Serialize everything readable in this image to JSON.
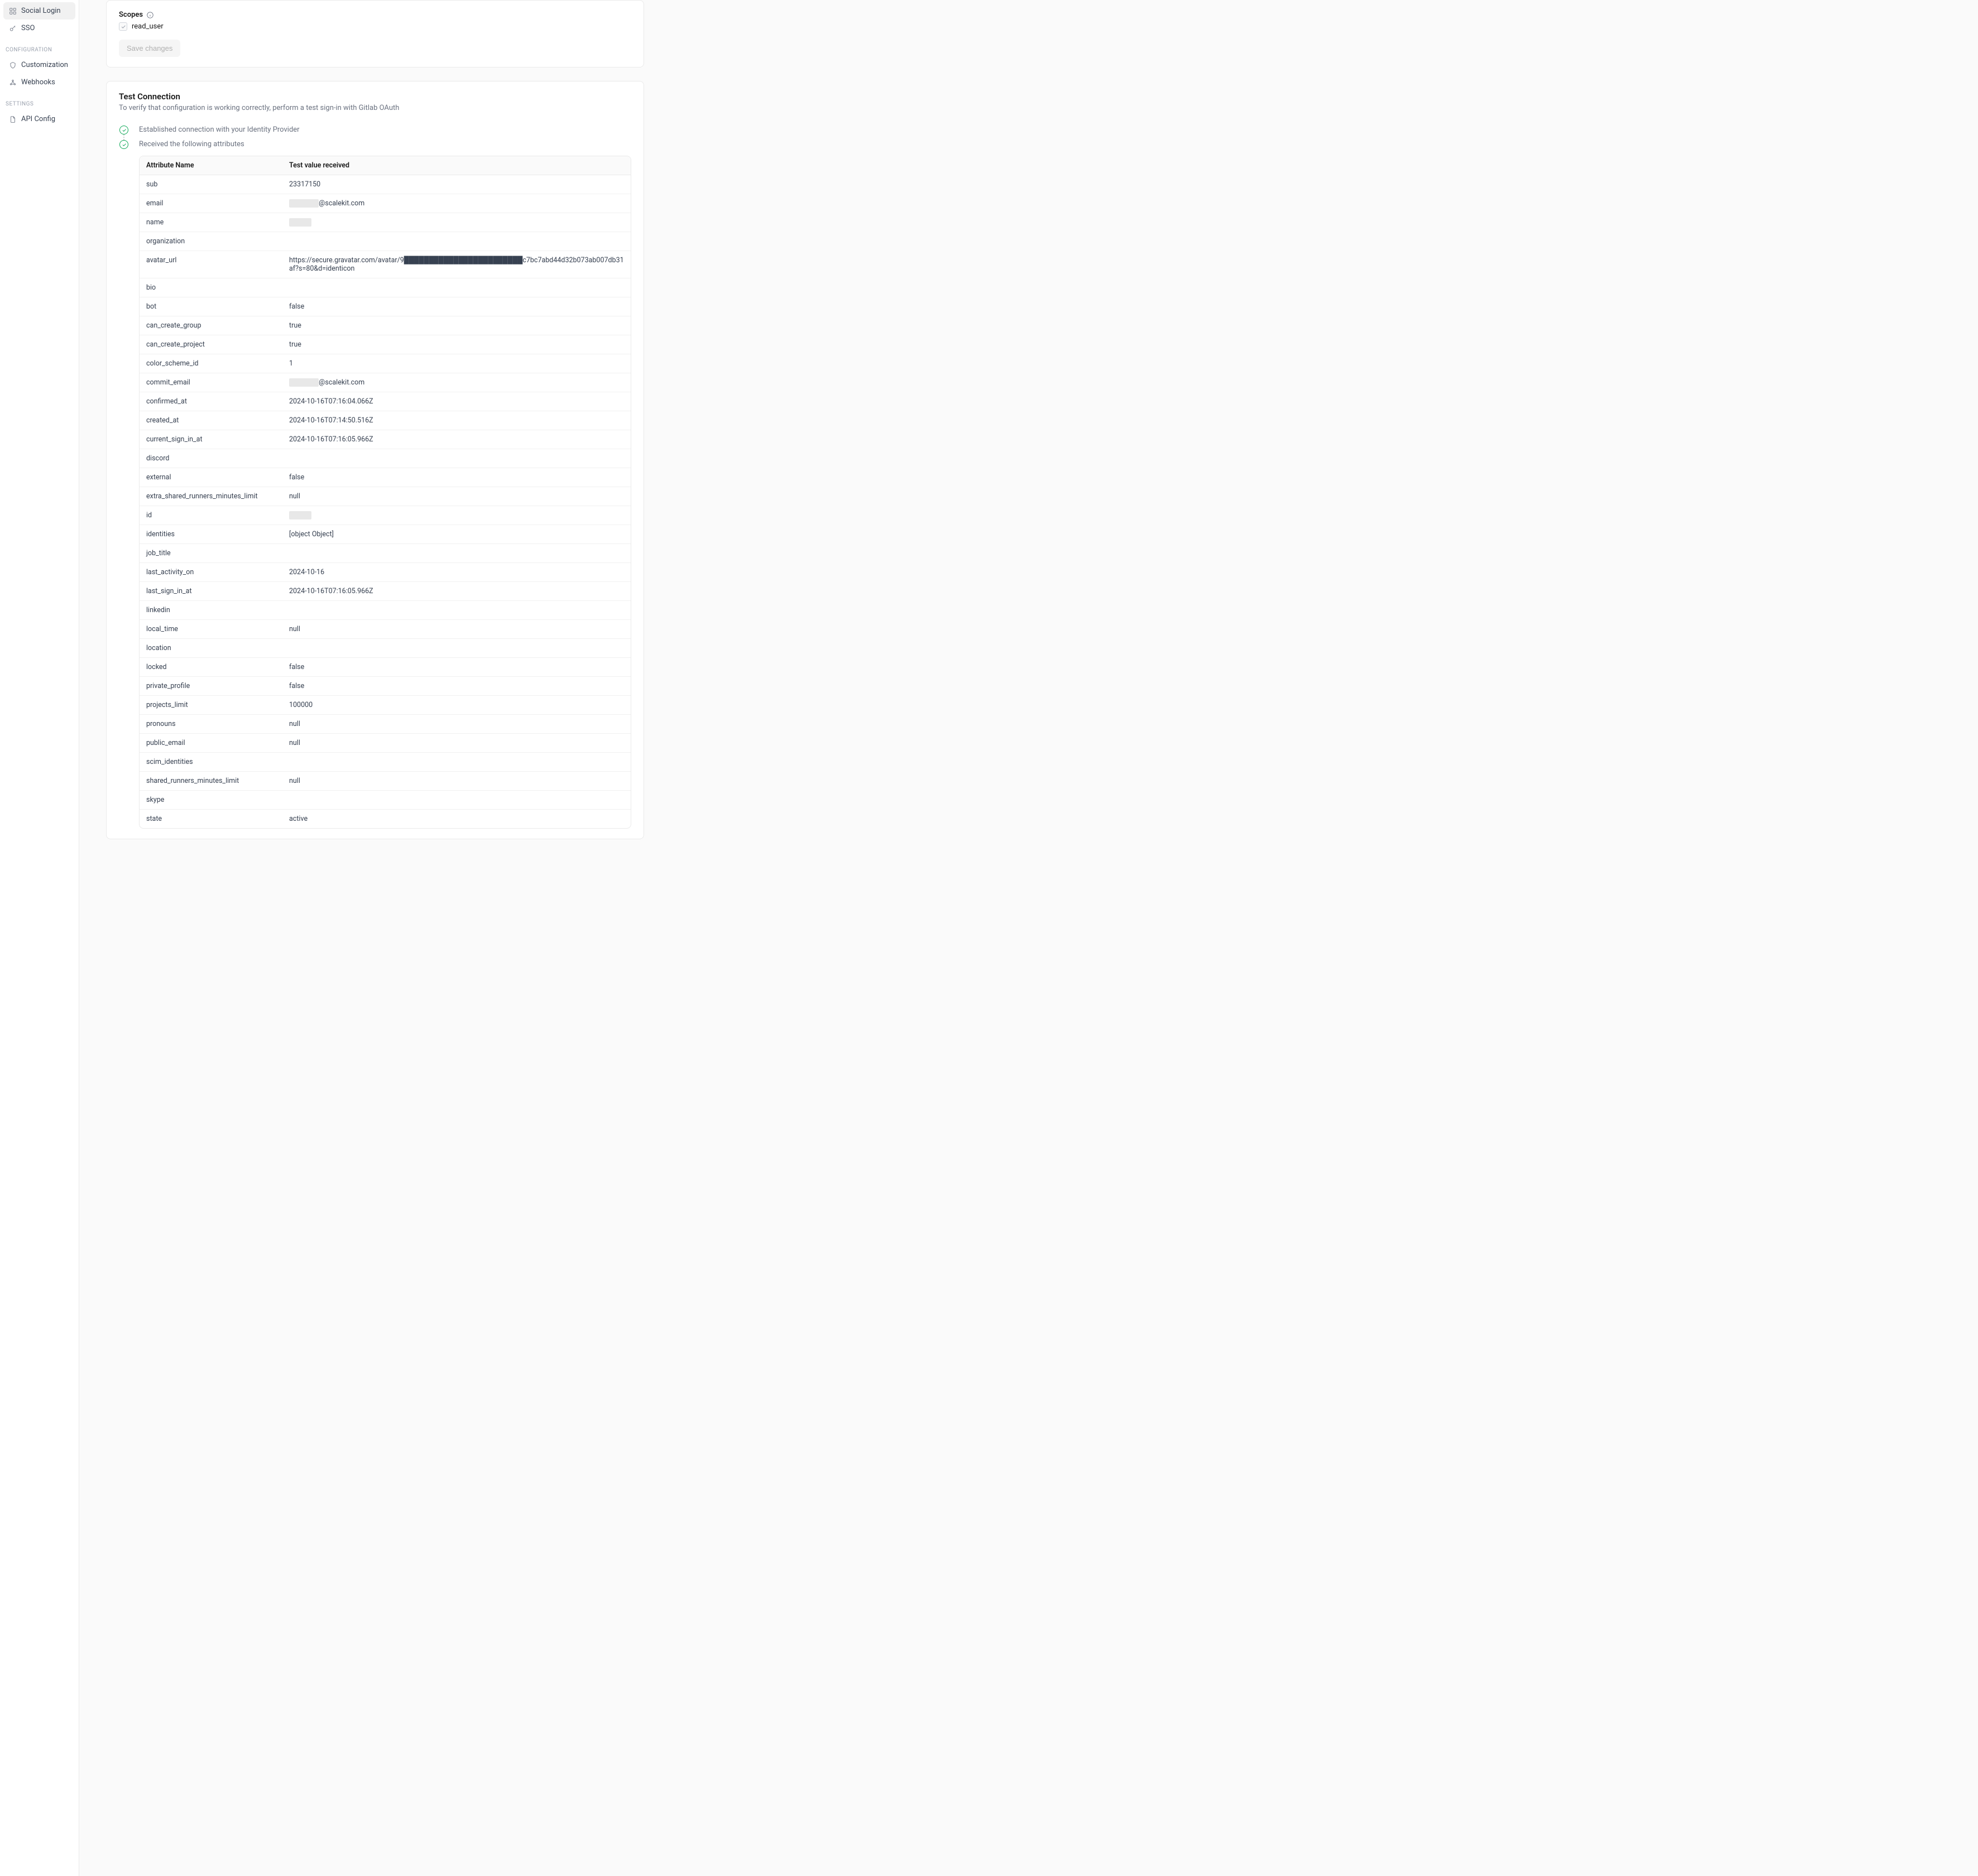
{
  "sidebar": {
    "items": {
      "social_login": "Social Login",
      "sso": "SSO",
      "customization": "Customization",
      "webhooks": "Webhooks",
      "api_config": "API Config"
    },
    "sections": {
      "configuration": "CONFIGURATION",
      "settings": "SETTINGS"
    }
  },
  "scopes": {
    "title": "Scopes",
    "item": "read_user",
    "save_button": "Save changes"
  },
  "test": {
    "title": "Test Connection",
    "description": "To verify that configuration is working correctly, perform a test sign-in with Gitlab OAuth",
    "step1": "Established connection with your Identity Provider",
    "step2": "Received the following attributes",
    "table": {
      "col1": "Attribute Name",
      "col2": "Test value received",
      "rows": [
        {
          "name": "sub",
          "value": "23317150"
        },
        {
          "name": "email",
          "value": "",
          "redacted_email": true,
          "domain": "@scalekit.com"
        },
        {
          "name": "name",
          "value": "",
          "redacted": true
        },
        {
          "name": "organization",
          "value": ""
        },
        {
          "name": "avatar_url",
          "value": "https://secure.gravatar.com/avatar/9████████████████████████c7bc7abd44d32b073ab007db31af?s=80&d=identicon"
        },
        {
          "name": "bio",
          "value": ""
        },
        {
          "name": "bot",
          "value": "false"
        },
        {
          "name": "can_create_group",
          "value": "true"
        },
        {
          "name": "can_create_project",
          "value": "true"
        },
        {
          "name": "color_scheme_id",
          "value": "1"
        },
        {
          "name": "commit_email",
          "value": "",
          "redacted_email": true,
          "domain": "@scalekit.com"
        },
        {
          "name": "confirmed_at",
          "value": "2024-10-16T07:16:04.066Z"
        },
        {
          "name": "created_at",
          "value": "2024-10-16T07:14:50.516Z"
        },
        {
          "name": "current_sign_in_at",
          "value": "2024-10-16T07:16:05.966Z"
        },
        {
          "name": "discord",
          "value": ""
        },
        {
          "name": "external",
          "value": "false"
        },
        {
          "name": "extra_shared_runners_minutes_limit",
          "value": "null"
        },
        {
          "name": "id",
          "value": "",
          "redacted": true
        },
        {
          "name": "identities",
          "value": "[object Object]"
        },
        {
          "name": "job_title",
          "value": ""
        },
        {
          "name": "last_activity_on",
          "value": "2024-10-16"
        },
        {
          "name": "last_sign_in_at",
          "value": "2024-10-16T07:16:05.966Z"
        },
        {
          "name": "linkedin",
          "value": ""
        },
        {
          "name": "local_time",
          "value": "null"
        },
        {
          "name": "location",
          "value": ""
        },
        {
          "name": "locked",
          "value": "false"
        },
        {
          "name": "private_profile",
          "value": "false"
        },
        {
          "name": "projects_limit",
          "value": "100000"
        },
        {
          "name": "pronouns",
          "value": "null"
        },
        {
          "name": "public_email",
          "value": "null"
        },
        {
          "name": "scim_identities",
          "value": ""
        },
        {
          "name": "shared_runners_minutes_limit",
          "value": "null"
        },
        {
          "name": "skype",
          "value": ""
        },
        {
          "name": "state",
          "value": "active"
        }
      ]
    }
  }
}
